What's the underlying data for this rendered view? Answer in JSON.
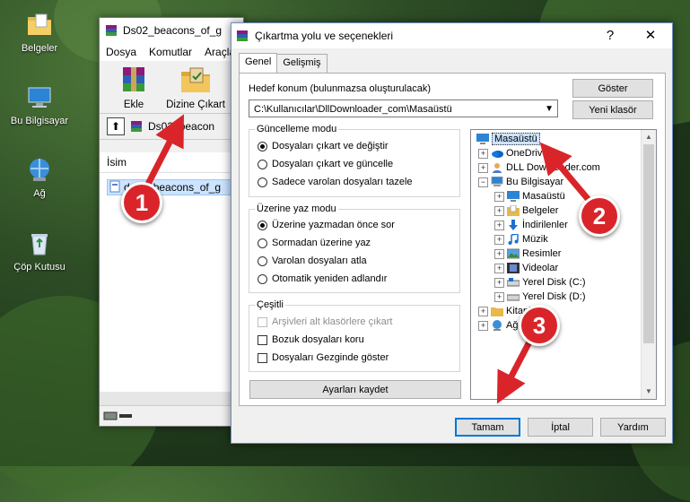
{
  "desktop": {
    "icons": [
      {
        "label": "Belgeler",
        "icon": "folder-documents-icon"
      },
      {
        "label": "Bu Bilgisayar",
        "icon": "computer-icon"
      },
      {
        "label": "Ağ",
        "icon": "network-icon"
      },
      {
        "label": "Çöp Kutusu",
        "icon": "recycle-bin-icon"
      }
    ]
  },
  "winrar": {
    "title": "Ds02_beacons_of_g",
    "menu": [
      "Dosya",
      "Komutlar",
      "Araçla"
    ],
    "tools": [
      {
        "label": "Ekle",
        "icon": "add-archive-icon"
      },
      {
        "label": "Dizine Çıkart",
        "icon": "extract-to-icon"
      }
    ],
    "path": "Ds02_beacon",
    "column_name": "İsim",
    "selected_file": "ds02_beacons_of_g"
  },
  "dialog": {
    "title": "Çıkartma yolu ve seçenekleri",
    "close": "✕",
    "help": "?",
    "tabs": [
      "Genel",
      "Gelişmiş"
    ],
    "destination_label": "Hedef konum (bulunmazsa oluşturulacak)",
    "destination_value": "C:\\Kullanıcılar\\DllDownloader_com\\Masaüstü",
    "show_button": "Göster",
    "new_folder_button": "Yeni klasör",
    "update_mode": {
      "title": "Güncelleme modu",
      "options": [
        "Dosyaları çıkart ve değiştir",
        "Dosyaları çıkart ve güncelle",
        "Sadece varolan dosyaları tazele"
      ],
      "selected": 0
    },
    "overwrite_mode": {
      "title": "Üzerine yaz modu",
      "options": [
        "Üzerine yazmadan önce sor",
        "Sormadan üzerine yaz",
        "Varolan dosyaları atla",
        "Otomatik yeniden adlandır"
      ],
      "selected": 0
    },
    "misc": {
      "title": "Çeşitli",
      "options": [
        {
          "label": "Arşivleri alt klasörlere çıkart",
          "disabled": true
        },
        {
          "label": "Bozuk dosyaları koru",
          "disabled": false
        },
        {
          "label": "Dosyaları Gezginde göster",
          "disabled": false
        }
      ]
    },
    "save_settings_button": "Ayarları kaydet",
    "tree": [
      {
        "label": "Masaüstü",
        "level": 0,
        "icon": "desktop-icon",
        "selected": true
      },
      {
        "label": "OneDrive",
        "level": 1,
        "icon": "onedrive-icon"
      },
      {
        "label": "DLL Downloader.com",
        "level": 1,
        "icon": "user-icon"
      },
      {
        "label": "Bu Bilgisayar",
        "level": 1,
        "icon": "computer-icon",
        "expanded": true
      },
      {
        "label": "Masaüstü",
        "level": 2,
        "icon": "desktop-icon"
      },
      {
        "label": "Belgeler",
        "level": 2,
        "icon": "documents-icon"
      },
      {
        "label": "İndirilenler",
        "level": 2,
        "icon": "downloads-icon"
      },
      {
        "label": "Müzik",
        "level": 2,
        "icon": "music-icon"
      },
      {
        "label": "Resimler",
        "level": 2,
        "icon": "pictures-icon"
      },
      {
        "label": "Videolar",
        "level": 2,
        "icon": "videos-icon"
      },
      {
        "label": "Yerel Disk (C:)",
        "level": 2,
        "icon": "drive-icon"
      },
      {
        "label": "Yerel Disk (D:)",
        "level": 2,
        "icon": "drive-icon"
      },
      {
        "label": "Kitaplıklar",
        "level": 1,
        "icon": "library-icon"
      },
      {
        "label": "Ağ",
        "level": 1,
        "icon": "network-icon"
      }
    ],
    "ok_button": "Tamam",
    "cancel_button": "İptal",
    "help_button": "Yardım"
  },
  "annotations": [
    "1",
    "2",
    "3"
  ],
  "colors": {
    "marker": "#d9252a",
    "selection": "#cce4ff",
    "accent": "#0078d7"
  }
}
